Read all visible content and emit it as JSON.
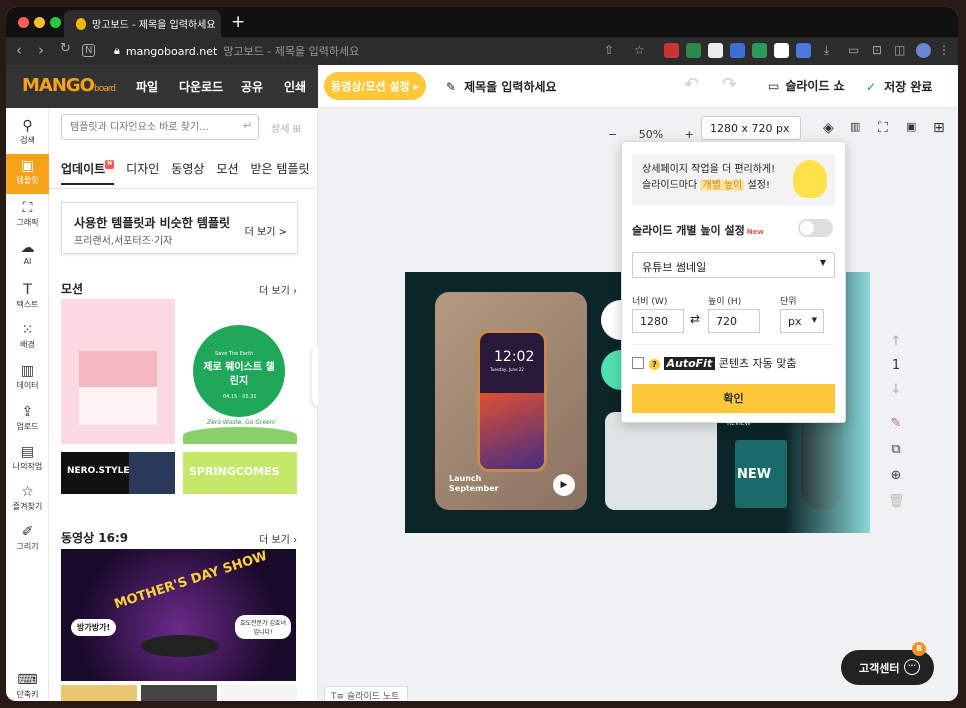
{
  "browser": {
    "tab_title": "망고보드 - 제목을 입력하세요",
    "new_tab": "+",
    "url_host": "mangoboard.net",
    "url_title": "망고보드 - 제목을 입력하세요"
  },
  "app": {
    "logo": "MANGO",
    "logo_sub": "board",
    "menu": [
      "파일",
      "다운로드",
      "공유",
      "인쇄"
    ],
    "motion_button": "동영상/모션 설정 ▸",
    "title_placeholder": "제목을 입력하세요",
    "slideshow": "슬라이드 쇼",
    "saved": "저장 완료"
  },
  "rail": [
    {
      "label": "검색",
      "icon": "search-icon"
    },
    {
      "label": "템플릿",
      "icon": "template-icon"
    },
    {
      "label": "그래픽",
      "icon": "graphic-icon"
    },
    {
      "label": "AI",
      "icon": "ai-icon"
    },
    {
      "label": "텍스트",
      "icon": "text-icon"
    },
    {
      "label": "배경",
      "icon": "background-icon"
    },
    {
      "label": "데이터",
      "icon": "chart-icon"
    },
    {
      "label": "업로드",
      "icon": "upload-icon"
    },
    {
      "label": "나의작업",
      "icon": "my-work-icon"
    },
    {
      "label": "즐겨찾기",
      "icon": "star-icon"
    },
    {
      "label": "그리기",
      "icon": "draw-icon"
    },
    {
      "label": "단축키",
      "icon": "keyboard-icon"
    }
  ],
  "panel": {
    "search_placeholder": "템플릿과 디자인요소 바로 찾기...",
    "detail": "상세",
    "tabs": [
      "업데이트",
      "디자인",
      "동영상",
      "모션",
      "받은 템플릿"
    ],
    "reco_title": "사용한 템플릿과 비슷한 템플릿",
    "reco_sub": "프리랜서,서포터즈·기자",
    "more": "더 보기 >",
    "section_motion": "모션",
    "section_video": "동영상 16:9",
    "more_link": "더 보기",
    "thumb_texts": {
      "save_earth": "Save The Earth",
      "zero_waste": "제로 웨이스트 챌린지",
      "dates": "04.15 - 05.31",
      "green": "Zero Waste, Go Green!",
      "nero": "NERO.STYLE",
      "spring": "SPRINGCOMES",
      "mothers": "MOTHER'S DAY SHOW",
      "bangga": "방가방가!",
      "hyodo": "효도전문가 김효녀입니다!"
    }
  },
  "canvas": {
    "zoom_minus": "−",
    "zoom": "50%",
    "zoom_plus": "+",
    "size": "1280 x 720 px",
    "slide_texts": {
      "time": "12:02",
      "date": "Tuesday, June 22",
      "launch": "Launch September",
      "review": "REVIEW",
      "new": "NEW"
    },
    "page_number": "1",
    "note": "슬라이드 노트"
  },
  "popup": {
    "tip_line1": "상세페이지 작업을 더 편리하게!",
    "tip_line2_a": "슬라이드마다 ",
    "tip_highlight": "개별 높이",
    "tip_line2_b": " 설정!",
    "toggle_label": "슬라이드 개별 높이 설정",
    "toggle_new": "New",
    "preset": "유튜브 썸네일",
    "width_label": "너비 (W)",
    "height_label": "높이 (H)",
    "unit_label": "단위",
    "width_value": "1280",
    "height_value": "720",
    "unit_value": "px",
    "autofit_brand": "AutoFit",
    "autofit_label": "콘텐츠 자동 맞춤",
    "confirm": "확인"
  },
  "help": {
    "label": "고객센터",
    "badge": "8"
  },
  "colors": {
    "brand": "#f7a21b",
    "accent_yellow": "#ffc83a",
    "dark_bar": "#333333",
    "saved_check": "#19a05a"
  }
}
